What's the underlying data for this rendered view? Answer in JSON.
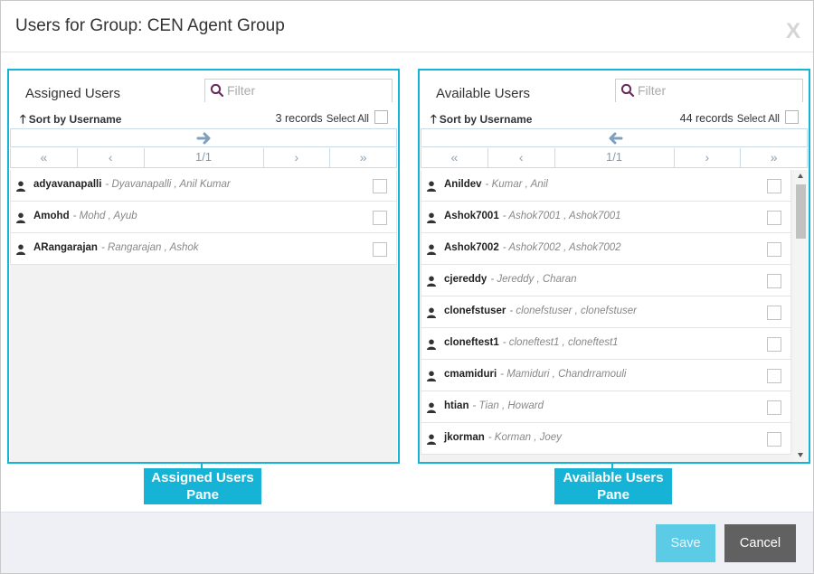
{
  "dialog": {
    "title": "Users for Group: CEN Agent Group",
    "close_label": "X"
  },
  "assigned": {
    "title": "Assigned Users",
    "filter_placeholder": "Filter",
    "sort_label": "Sort by Username",
    "records": "3 records",
    "select_all": "Select All",
    "pager": {
      "first": "«",
      "prev": "‹",
      "page": "1/1",
      "next": "›",
      "last": "»"
    },
    "users": [
      {
        "username": "adyavanapalli",
        "fullname": "- Dyavanapalli , Anil Kumar"
      },
      {
        "username": "Amohd",
        "fullname": "- Mohd , Ayub"
      },
      {
        "username": "ARangarajan",
        "fullname": "- Rangarajan , Ashok"
      }
    ]
  },
  "available": {
    "title": "Available Users",
    "filter_placeholder": "Filter",
    "sort_label": "Sort by Username",
    "records": "44 records",
    "select_all": "Select All",
    "pager": {
      "first": "«",
      "prev": "‹",
      "page": "1/1",
      "next": "›",
      "last": "»"
    },
    "users": [
      {
        "username": "Anildev",
        "fullname": "- Kumar , Anil"
      },
      {
        "username": "Ashok7001",
        "fullname": "- Ashok7001 , Ashok7001"
      },
      {
        "username": "Ashok7002",
        "fullname": "- Ashok7002 , Ashok7002"
      },
      {
        "username": "cjereddy",
        "fullname": "- Jereddy , Charan"
      },
      {
        "username": "clonefstuser",
        "fullname": "- clonefstuser , clonefstuser"
      },
      {
        "username": "cloneftest1",
        "fullname": "- cloneftest1 , cloneftest1"
      },
      {
        "username": "cmamiduri",
        "fullname": "- Mamiduri , Chandrramouli"
      },
      {
        "username": "htian",
        "fullname": "- Tian , Howard"
      },
      {
        "username": "jkorman",
        "fullname": "- Korman , Joey"
      }
    ]
  },
  "callouts": {
    "assigned": "Assigned Users Pane",
    "available": "Available Users Pane"
  },
  "footer": {
    "save_label": "Save",
    "cancel_label": "Cancel"
  },
  "icons": {
    "filter": "search-icon",
    "move_right": "arrow-right-icon",
    "move_left": "arrow-left-icon",
    "sort": "arrow-up-icon",
    "user": "user-icon"
  },
  "colors": {
    "accent": "#17b3d6",
    "search_icon": "#6b2a5e",
    "save_button": "#5ccbe6",
    "cancel_button": "#616161",
    "move_arrow": "#7f9fbf"
  }
}
